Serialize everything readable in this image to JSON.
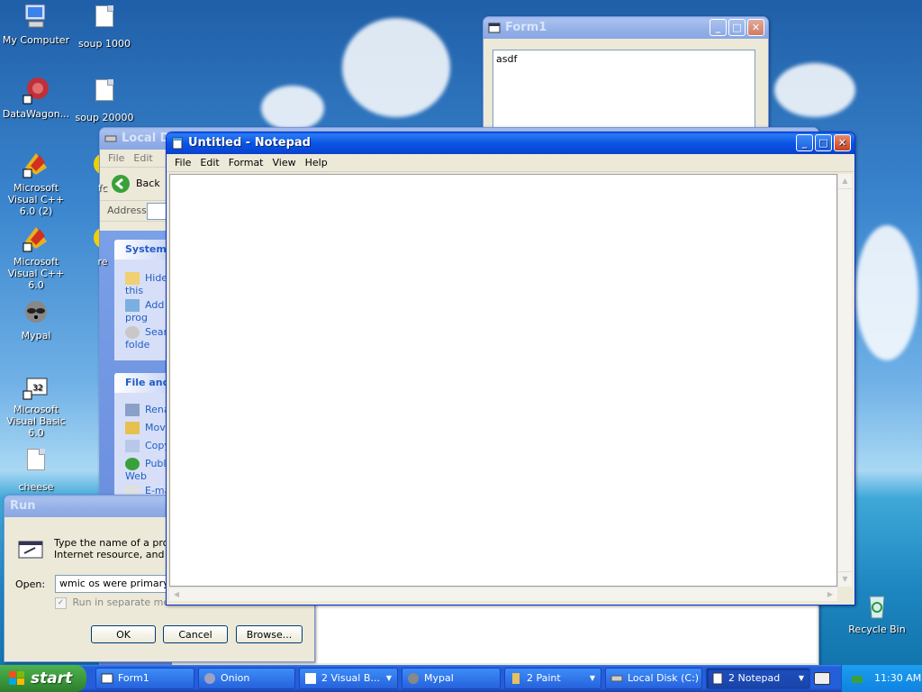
{
  "desktop_icons": [
    {
      "label": "My Computer"
    },
    {
      "label": "soup 1000"
    },
    {
      "label": "DataWagon..."
    },
    {
      "label": "soup 20000"
    },
    {
      "label": "Microsoft Visual C++ 6.0 (2)"
    },
    {
      "label": "Microsoft Visual C++ 6.0"
    },
    {
      "label": "Mypal"
    },
    {
      "label": "Microsoft Visual Basic 6.0"
    },
    {
      "label": "cheese"
    },
    {
      "label": "Recycle Bin"
    },
    {
      "label": "fc"
    },
    {
      "label": "re"
    }
  ],
  "form1": {
    "title": "Form1",
    "textbox_value": "asdf"
  },
  "explorer": {
    "title": "Local Di",
    "menu": [
      "File",
      "Edit"
    ],
    "back_label": "Back",
    "address_label": "Address",
    "system_tasks": {
      "header": "System",
      "items": [
        "Hide this",
        "Add prog",
        "Sear folde"
      ]
    },
    "file_tasks": {
      "header": "File and",
      "items": [
        "Rena",
        "Move",
        "Copy",
        "Publ Web",
        "E-ma"
      ]
    }
  },
  "notepad": {
    "title": "Untitled - Notepad",
    "menu": [
      "File",
      "Edit",
      "Format",
      "View",
      "Help"
    ],
    "content": ""
  },
  "run_dialog": {
    "title": "Run",
    "description": "Type the name of a progr\nInternet resource, and W",
    "open_label": "Open:",
    "open_value": "wmic os were primary =1",
    "checkbox_label": "Run in separate memo",
    "ok_label": "OK",
    "cancel_label": "Cancel",
    "browse_label": "Browse..."
  },
  "taskbar": {
    "start_label": "start",
    "tasks": [
      {
        "label": "Form1"
      },
      {
        "label": "Onion"
      },
      {
        "label": "2 Visual B..."
      },
      {
        "label": "Mypal"
      },
      {
        "label": "2 Paint"
      },
      {
        "label": "Local Disk (C:)"
      },
      {
        "label": "2 Notepad"
      }
    ],
    "clock": "11:30 AM"
  },
  "colors": {
    "title_active": "#0a5fe8",
    "taskbar": "#245edb",
    "start_green": "#3c9a3c",
    "window_face": "#ece9d8"
  }
}
